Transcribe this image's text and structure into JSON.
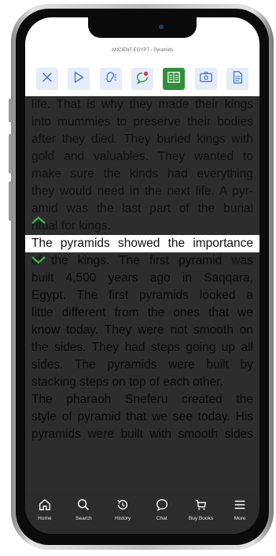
{
  "header": {
    "book_title": "ANCIENT EGYPT - Pyramids"
  },
  "toolbar": {
    "buttons": [
      {
        "icon": "close-icon",
        "active": false
      },
      {
        "icon": "play-icon",
        "active": false
      },
      {
        "icon": "listen-icon",
        "active": false
      },
      {
        "icon": "comment-icon",
        "active": false
      },
      {
        "icon": "book-icon",
        "active": true
      },
      {
        "icon": "settings-icon",
        "active": false
      },
      {
        "icon": "document-icon",
        "active": false
      }
    ]
  },
  "reader": {
    "lines": [
      "life. That is why they made their kings",
      "into mummies to preserve their bodies",
      "after they died. They buried kings with",
      "gold and valuables. They wanted to",
      "make sure the kinds had everything",
      "they would need in the next life. A pyr-",
      "amid was the last part of the burial",
      "ritual for kings.",
      "The pyramids showed the importance",
      "of the kings. The first pyramid was",
      "built 4,500 years ago in Saqqara,",
      "Egypt. The first pyramids looked a",
      "little different from the ones that we",
      "know today. They were not smooth on",
      "the sides. They had steps going up all",
      "sides. The pyramids were built by",
      "stacking steps on top of each other.",
      "The pharaoh Sneferu created the",
      "style of pyramid that we see today. His",
      "pyramids were built with smooth sides"
    ],
    "highlight_color": "#ffffff"
  },
  "bottom_nav": {
    "items": [
      {
        "label": "Home",
        "icon": "home-icon"
      },
      {
        "label": "Search",
        "icon": "search-icon"
      },
      {
        "label": "History",
        "icon": "history-icon"
      },
      {
        "label": "Chat",
        "icon": "chat-icon"
      },
      {
        "label": "Buy Books",
        "icon": "cart-icon"
      },
      {
        "label": "More",
        "icon": "menu-icon"
      }
    ]
  },
  "colors": {
    "accent": "#3f74c8",
    "active": "#2f8f3a",
    "arrow": "#3fb44a"
  }
}
